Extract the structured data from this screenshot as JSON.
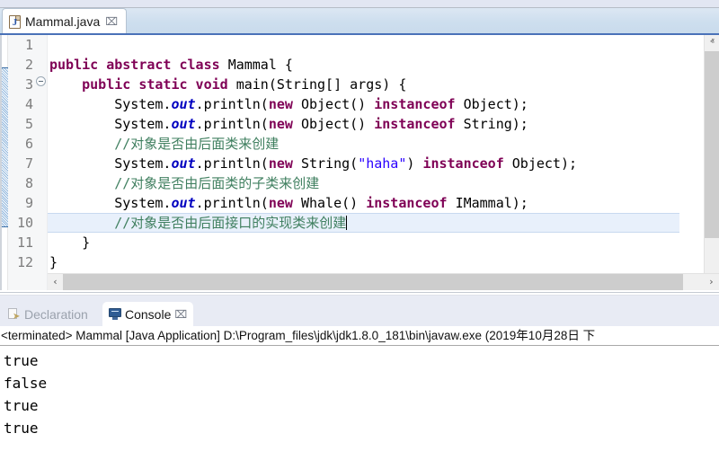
{
  "window": {
    "title": "Mammal.java"
  },
  "editor": {
    "tab": {
      "label": "Mammal.java",
      "icon": "java-file-icon",
      "close_label": "⌧",
      "glyph": "J"
    },
    "line_numbers": [
      "1",
      "2",
      "3",
      "4",
      "5",
      "6",
      "7",
      "8",
      "9",
      "10",
      "11",
      "12"
    ],
    "fold_marker": "collapse-fold-icon",
    "current_line": 10,
    "lines": [
      {
        "n": "1",
        "segments": []
      },
      {
        "n": "2",
        "segments": [
          {
            "t": "public abstract class ",
            "c": "kw"
          },
          {
            "t": "Mammal {",
            "c": ""
          }
        ]
      },
      {
        "n": "3",
        "segments": [
          {
            "t": "    ",
            "c": ""
          },
          {
            "t": "public static void ",
            "c": "kw"
          },
          {
            "t": "main(String[] args) {",
            "c": ""
          }
        ]
      },
      {
        "n": "4",
        "segments": [
          {
            "t": "        System.",
            "c": ""
          },
          {
            "t": "out",
            "c": "fld"
          },
          {
            "t": ".println(",
            "c": ""
          },
          {
            "t": "new ",
            "c": "kw"
          },
          {
            "t": "Object() ",
            "c": ""
          },
          {
            "t": "instanceof ",
            "c": "kw"
          },
          {
            "t": "Object);",
            "c": ""
          }
        ]
      },
      {
        "n": "5",
        "segments": [
          {
            "t": "        System.",
            "c": ""
          },
          {
            "t": "out",
            "c": "fld"
          },
          {
            "t": ".println(",
            "c": ""
          },
          {
            "t": "new ",
            "c": "kw"
          },
          {
            "t": "Object() ",
            "c": ""
          },
          {
            "t": "instanceof ",
            "c": "kw"
          },
          {
            "t": "String);",
            "c": ""
          }
        ]
      },
      {
        "n": "6",
        "segments": [
          {
            "t": "        //对象是否由后面类来创建",
            "c": "cmt"
          }
        ]
      },
      {
        "n": "7",
        "segments": [
          {
            "t": "        System.",
            "c": ""
          },
          {
            "t": "out",
            "c": "fld"
          },
          {
            "t": ".println(",
            "c": ""
          },
          {
            "t": "new ",
            "c": "kw"
          },
          {
            "t": "String(",
            "c": ""
          },
          {
            "t": "\"haha\"",
            "c": "str"
          },
          {
            "t": ") ",
            "c": ""
          },
          {
            "t": "instanceof ",
            "c": "kw"
          },
          {
            "t": "Object);",
            "c": ""
          }
        ]
      },
      {
        "n": "8",
        "segments": [
          {
            "t": "        //对象是否由后面类的子类来创建",
            "c": "cmt"
          }
        ]
      },
      {
        "n": "9",
        "segments": [
          {
            "t": "        System.",
            "c": ""
          },
          {
            "t": "out",
            "c": "fld"
          },
          {
            "t": ".println(",
            "c": ""
          },
          {
            "t": "new ",
            "c": "kw"
          },
          {
            "t": "Whale() ",
            "c": ""
          },
          {
            "t": "instanceof ",
            "c": "kw"
          },
          {
            "t": "IMammal);",
            "c": ""
          }
        ]
      },
      {
        "n": "10",
        "segments": [
          {
            "t": "        //对象是否由后面接口的实现类来创建",
            "c": "cmt"
          }
        ]
      },
      {
        "n": "11",
        "segments": [
          {
            "t": "    }",
            "c": ""
          }
        ]
      },
      {
        "n": "12",
        "segments": [
          {
            "t": "}",
            "c": ""
          }
        ]
      }
    ],
    "scrollbars": {
      "v_up": "ⱏ",
      "v_down": "ⱟ",
      "h_left": "‹",
      "h_right": "›"
    }
  },
  "bottom_panel": {
    "tabs": [
      {
        "label": "Declaration",
        "icon": "declaration-icon",
        "active": false
      },
      {
        "label": "Console",
        "icon": "console-monitor-icon",
        "active": true,
        "close_label": "⌧"
      }
    ],
    "status_line": "<terminated> Mammal [Java Application] D:\\Program_files\\jdk\\jdk1.8.0_181\\bin\\javaw.exe (2019年10月28日 下",
    "output_lines": [
      "true",
      "false",
      "true",
      "true"
    ]
  },
  "colors": {
    "keyword": "#7f0055",
    "field": "#0000c0",
    "comment": "#3f7f5f",
    "string": "#2a00ff",
    "tab_underline": "#4a72b8",
    "current_line": "#e8f0fb"
  }
}
